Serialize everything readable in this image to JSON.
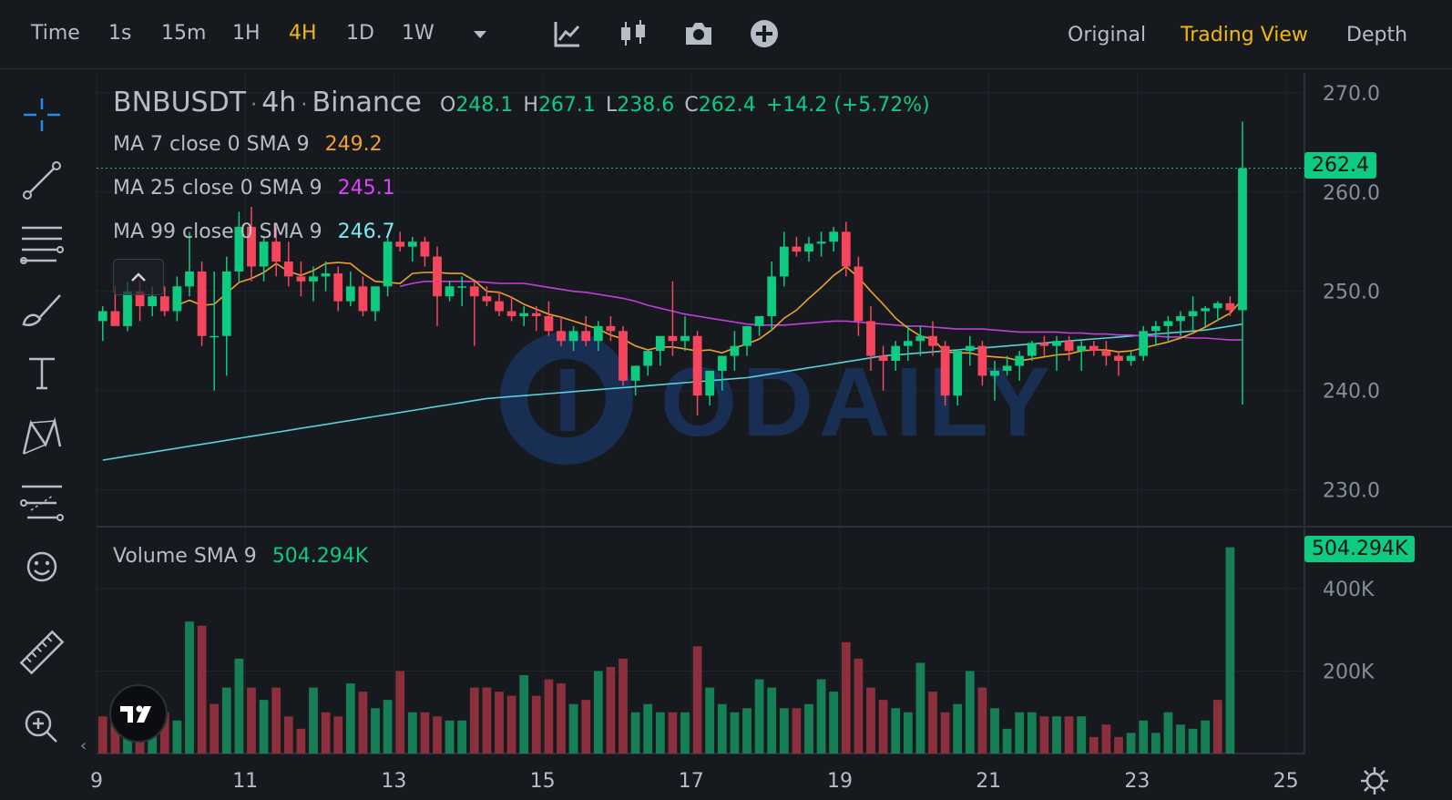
{
  "toolbar": {
    "intervals": [
      {
        "label": "Time",
        "active": false
      },
      {
        "label": "1s",
        "active": false
      },
      {
        "label": "15m",
        "active": false
      },
      {
        "label": "1H",
        "active": false
      },
      {
        "label": "4H",
        "active": true
      },
      {
        "label": "1D",
        "active": false
      },
      {
        "label": "1W",
        "active": false
      }
    ],
    "tools": [
      "indicator-icon",
      "chart-type-icon",
      "screenshot-icon",
      "add-icon"
    ],
    "views": [
      {
        "label": "Original",
        "active": false
      },
      {
        "label": "Trading View",
        "active": true
      },
      {
        "label": "Depth",
        "active": false
      }
    ]
  },
  "sidebar": {
    "tools": [
      "crosshair-icon",
      "trend-line-icon",
      "horizontal-lines-icon",
      "brush-icon",
      "text-icon",
      "pattern-icon",
      "forecast-icon",
      "emoji-icon",
      "ruler-icon",
      "zoom-in-icon"
    ]
  },
  "legend": {
    "symbol": "BNBUSDT",
    "interval": "4h",
    "exchange": "Binance",
    "o_label": "O",
    "o_value": "248.1",
    "h_label": "H",
    "h_value": "267.1",
    "l_label": "L",
    "l_value": "238.6",
    "c_label": "C",
    "c_value": "262.4",
    "change": "+14.2 (+5.72%)",
    "ma7_label": "MA 7 close 0 SMA 9",
    "ma7_value": "249.2",
    "ma25_label": "MA 25 close 0 SMA 9",
    "ma25_value": "245.1",
    "ma99_label": "MA 99 close 0 SMA 9",
    "ma99_value": "246.7",
    "volume_label": "Volume SMA 9",
    "volume_value": "504.294K"
  },
  "watermark": "ODAILY",
  "current_price_tag": "262.4",
  "current_volume_tag": "504.294K",
  "colors": {
    "up": "#0ecb81",
    "down": "#f6465d",
    "vol_up": "#167f55",
    "vol_down": "#8c2f3c",
    "ma7": "#f0a02c",
    "ma25": "#c43fd9",
    "ma99": "#5ccfdc",
    "accent": "#f0b90b",
    "background": "#161a1e"
  },
  "chart_data": {
    "type": "candlestick",
    "price_axis": {
      "ticks": [
        "270.0",
        "260.0",
        "250.0",
        "240.0",
        "230.0"
      ],
      "range": [
        226.3,
        272.0
      ]
    },
    "volume_axis": {
      "ticks": [
        "400K",
        "200K"
      ],
      "range": [
        0,
        550000
      ]
    },
    "x_axis": {
      "ticks": [
        "9",
        "11",
        "13",
        "15",
        "17",
        "19",
        "21",
        "23",
        "25"
      ],
      "range": [
        9.0,
        25.25
      ],
      "candle_hours": 4
    },
    "candles_start_day": 9.0,
    "ohlc": [
      [
        247.0,
        248.5,
        245.0,
        248.0
      ],
      [
        248.0,
        250.5,
        247.0,
        246.5
      ],
      [
        246.5,
        251.0,
        246.0,
        250.0
      ],
      [
        250.0,
        251.0,
        247.0,
        248.5
      ],
      [
        248.5,
        250.5,
        247.5,
        249.5
      ],
      [
        249.5,
        250.5,
        247.5,
        248.0
      ],
      [
        248.0,
        251.5,
        247.0,
        250.5
      ],
      [
        250.5,
        256.0,
        249.5,
        252.0
      ],
      [
        252.0,
        253.0,
        244.5,
        245.5
      ],
      [
        245.5,
        252.0,
        240.0,
        245.5
      ],
      [
        245.5,
        253.5,
        241.5,
        252.0
      ],
      [
        252.0,
        258.0,
        251.0,
        256.5
      ],
      [
        256.5,
        258.5,
        251.0,
        252.5
      ],
      [
        252.5,
        255.5,
        251.0,
        255.0
      ],
      [
        255.0,
        256.5,
        251.5,
        253.0
      ],
      [
        253.0,
        255.0,
        250.5,
        251.5
      ],
      [
        251.5,
        253.0,
        249.5,
        251.0
      ],
      [
        251.0,
        252.5,
        249.0,
        251.5
      ],
      [
        251.5,
        253.0,
        250.0,
        251.8
      ],
      [
        251.8,
        252.5,
        248.0,
        249.0
      ],
      [
        249.0,
        252.0,
        248.5,
        250.5
      ],
      [
        250.5,
        251.5,
        247.5,
        248.0
      ],
      [
        248.0,
        250.0,
        247.0,
        250.5
      ],
      [
        250.5,
        255.5,
        249.5,
        255.0
      ],
      [
        255.0,
        256.0,
        254.0,
        254.5
      ],
      [
        254.5,
        255.5,
        253.0,
        255.0
      ],
      [
        255.0,
        255.5,
        252.5,
        253.5
      ],
      [
        253.5,
        254.5,
        246.5,
        249.5
      ],
      [
        249.5,
        251.0,
        249.0,
        250.5
      ],
      [
        250.5,
        251.5,
        248.5,
        250.5
      ],
      [
        250.5,
        251.0,
        244.5,
        249.5
      ],
      [
        249.5,
        250.5,
        248.5,
        249.0
      ],
      [
        249.0,
        250.0,
        247.5,
        248.0
      ],
      [
        248.0,
        249.5,
        247.0,
        247.5
      ],
      [
        247.5,
        248.5,
        246.5,
        247.8
      ],
      [
        247.8,
        248.5,
        246.0,
        247.5
      ],
      [
        247.5,
        249.0,
        245.5,
        246.0
      ],
      [
        246.0,
        247.5,
        244.5,
        245.0
      ],
      [
        245.0,
        246.5,
        244.0,
        246.0
      ],
      [
        246.0,
        247.5,
        244.5,
        245.0
      ],
      [
        245.0,
        247.0,
        244.0,
        246.5
      ],
      [
        246.5,
        247.5,
        245.0,
        246.0
      ],
      [
        246.0,
        246.5,
        240.5,
        241.0
      ],
      [
        241.0,
        242.5,
        239.5,
        242.5
      ],
      [
        242.5,
        244.0,
        241.5,
        244.0
      ],
      [
        244.0,
        245.5,
        242.5,
        245.5
      ],
      [
        245.5,
        251.0,
        243.5,
        245.0
      ],
      [
        245.0,
        247.5,
        244.0,
        245.5
      ],
      [
        245.5,
        246.0,
        237.5,
        239.5
      ],
      [
        239.5,
        241.5,
        238.5,
        242.0
      ],
      [
        242.0,
        243.5,
        240.0,
        243.5
      ],
      [
        243.5,
        246.0,
        242.0,
        244.5
      ],
      [
        244.5,
        246.5,
        243.5,
        246.5
      ],
      [
        246.5,
        247.5,
        245.5,
        247.5
      ],
      [
        247.5,
        253.0,
        246.0,
        251.5
      ],
      [
        251.5,
        256.0,
        250.5,
        254.5
      ],
      [
        254.5,
        255.5,
        253.5,
        254.0
      ],
      [
        254.0,
        255.5,
        253.0,
        254.8
      ],
      [
        254.8,
        256.0,
        253.5,
        255.0
      ],
      [
        255.0,
        256.5,
        254.0,
        256.0
      ],
      [
        256.0,
        257.0,
        251.5,
        252.5
      ],
      [
        252.5,
        253.5,
        245.5,
        247.0
      ],
      [
        247.0,
        248.5,
        242.0,
        243.5
      ],
      [
        243.5,
        244.5,
        240.0,
        243.0
      ],
      [
        243.0,
        245.0,
        242.0,
        244.5
      ],
      [
        244.5,
        246.5,
        243.0,
        245.0
      ],
      [
        245.0,
        246.5,
        243.5,
        245.5
      ],
      [
        245.5,
        247.0,
        243.5,
        244.5
      ],
      [
        244.5,
        245.0,
        238.5,
        239.5
      ],
      [
        239.5,
        244.0,
        238.5,
        244.0
      ],
      [
        244.0,
        245.5,
        242.5,
        244.5
      ],
      [
        244.5,
        245.0,
        240.5,
        241.5
      ],
      [
        241.5,
        243.0,
        239.0,
        242.0
      ],
      [
        242.0,
        243.5,
        241.5,
        242.5
      ],
      [
        242.5,
        244.0,
        241.0,
        243.5
      ],
      [
        243.5,
        245.0,
        243.0,
        244.8
      ],
      [
        244.8,
        245.5,
        243.5,
        244.5
      ],
      [
        244.5,
        245.5,
        242.0,
        245.0
      ],
      [
        245.0,
        245.5,
        243.0,
        244.0
      ],
      [
        244.0,
        245.0,
        242.0,
        244.5
      ],
      [
        244.5,
        245.0,
        243.5,
        244.0
      ],
      [
        244.0,
        245.0,
        242.5,
        243.5
      ],
      [
        243.5,
        244.0,
        241.5,
        243.0
      ],
      [
        243.0,
        244.0,
        242.5,
        243.5
      ],
      [
        243.5,
        246.5,
        243.0,
        246.0
      ],
      [
        246.0,
        247.0,
        244.5,
        246.5
      ],
      [
        246.5,
        247.5,
        245.0,
        247.0
      ],
      [
        247.0,
        248.0,
        245.5,
        247.5
      ],
      [
        247.5,
        249.5,
        246.0,
        248.0
      ],
      [
        248.0,
        248.5,
        246.5,
        248.3
      ],
      [
        248.3,
        249.0,
        247.0,
        248.8
      ],
      [
        248.8,
        249.5,
        247.5,
        248.1
      ],
      [
        248.1,
        267.1,
        238.6,
        262.4
      ]
    ],
    "ma7": [
      null,
      null,
      null,
      null,
      null,
      null,
      248.6,
      249.1,
      248.6,
      248.7,
      249.8,
      250.9,
      251.3,
      251.9,
      252.8,
      252.0,
      251.6,
      252.1,
      252.8,
      252.9,
      252.8,
      251.8,
      251.0,
      250.9,
      250.8,
      251.8,
      251.9,
      251.9,
      251.8,
      251.8,
      251.1,
      250.0,
      249.9,
      249.4,
      248.7,
      248.2,
      247.7,
      247.4,
      247.0,
      246.6,
      246.2,
      245.6,
      245.2,
      244.5,
      244.1,
      244.4,
      244.4,
      244.2,
      244.0,
      244.1,
      243.8,
      244.3,
      244.7,
      245.2,
      246.1,
      247.3,
      248.1,
      249.3,
      250.4,
      251.6,
      252.5,
      251.4,
      250.0,
      248.7,
      247.3,
      246.3,
      245.5,
      245.2,
      243.9,
      243.8,
      243.8,
      243.5,
      243.4,
      243.3,
      243.0,
      243.2,
      243.4,
      243.6,
      243.7,
      244.0,
      244.1,
      244.1,
      243.9,
      244.0,
      244.3,
      244.6,
      244.9,
      245.3,
      245.8,
      246.4,
      247.1,
      247.8,
      249.2
    ],
    "ma25": [
      null,
      null,
      null,
      null,
      null,
      null,
      null,
      null,
      null,
      null,
      null,
      null,
      null,
      null,
      null,
      null,
      null,
      null,
      null,
      null,
      null,
      null,
      null,
      null,
      250.5,
      250.8,
      251.0,
      251.0,
      251.0,
      251.0,
      251.0,
      250.9,
      250.8,
      250.8,
      250.8,
      250.6,
      250.4,
      250.2,
      250.0,
      249.9,
      249.7,
      249.5,
      249.3,
      249.0,
      248.6,
      248.3,
      248.0,
      247.7,
      247.5,
      247.3,
      247.1,
      246.9,
      246.7,
      246.6,
      246.6,
      246.6,
      246.7,
      246.8,
      246.9,
      247.0,
      247.0,
      246.9,
      246.8,
      246.7,
      246.6,
      246.5,
      246.5,
      246.4,
      246.3,
      246.2,
      246.2,
      246.2,
      246.1,
      246.0,
      245.9,
      245.9,
      245.9,
      245.9,
      245.8,
      245.8,
      245.7,
      245.7,
      245.6,
      245.6,
      245.5,
      245.5,
      245.4,
      245.4,
      245.3,
      245.3,
      245.2,
      245.1,
      245.1
    ],
    "ma99": [
      233.0,
      233.2,
      233.4,
      233.6,
      233.8,
      234.0,
      234.2,
      234.4,
      234.6,
      234.8,
      235.0,
      235.2,
      235.4,
      235.6,
      235.8,
      236.0,
      236.2,
      236.4,
      236.6,
      236.8,
      237.0,
      237.2,
      237.4,
      237.6,
      237.8,
      238.0,
      238.2,
      238.4,
      238.6,
      238.8,
      239.0,
      239.2,
      239.3,
      239.4,
      239.5,
      239.6,
      239.7,
      239.8,
      239.9,
      240.0,
      240.1,
      240.2,
      240.3,
      240.4,
      240.5,
      240.6,
      240.7,
      240.8,
      240.9,
      241.0,
      241.1,
      241.2,
      241.3,
      241.5,
      241.7,
      241.9,
      242.1,
      242.3,
      242.5,
      242.7,
      242.9,
      243.1,
      243.3,
      243.5,
      243.6,
      243.7,
      243.8,
      243.9,
      244.0,
      244.1,
      244.2,
      244.3,
      244.4,
      244.5,
      244.6,
      244.7,
      244.8,
      244.9,
      245.0,
      245.1,
      245.2,
      245.3,
      245.4,
      245.5,
      245.6,
      245.7,
      245.8,
      245.9,
      246.0,
      246.1,
      246.3,
      246.5,
      246.7
    ],
    "volume": [
      90000,
      110000,
      80000,
      80000,
      90000,
      100000,
      80000,
      320000,
      310000,
      120000,
      160000,
      230000,
      160000,
      130000,
      160000,
      90000,
      60000,
      160000,
      100000,
      90000,
      170000,
      150000,
      110000,
      130000,
      200000,
      100000,
      100000,
      90000,
      80000,
      80000,
      160000,
      160000,
      150000,
      140000,
      190000,
      140000,
      180000,
      170000,
      120000,
      130000,
      200000,
      210000,
      230000,
      100000,
      120000,
      100000,
      100000,
      100000,
      260000,
      160000,
      120000,
      100000,
      110000,
      180000,
      160000,
      110000,
      110000,
      120000,
      180000,
      150000,
      270000,
      230000,
      160000,
      130000,
      110000,
      100000,
      220000,
      150000,
      100000,
      120000,
      200000,
      160000,
      110000,
      60000,
      100000,
      100000,
      90000,
      90000,
      90000,
      90000,
      40000,
      70000,
      40000,
      50000,
      80000,
      50000,
      100000,
      70000,
      60000,
      80000,
      130000,
      500000
    ],
    "volume_dirs": [
      "d",
      "d",
      "u",
      "d",
      "u",
      "d",
      "u",
      "u",
      "d",
      "d",
      "u",
      "u",
      "d",
      "u",
      "d",
      "d",
      "d",
      "u",
      "d",
      "d",
      "u",
      "d",
      "u",
      "u",
      "d",
      "u",
      "d",
      "d",
      "u",
      "u",
      "d",
      "d",
      "d",
      "d",
      "u",
      "d",
      "d",
      "d",
      "u",
      "d",
      "u",
      "d",
      "d",
      "u",
      "u",
      "u",
      "d",
      "u",
      "d",
      "u",
      "u",
      "u",
      "u",
      "u",
      "u",
      "u",
      "d",
      "u",
      "u",
      "u",
      "d",
      "d",
      "d",
      "d",
      "u",
      "u",
      "u",
      "d",
      "d",
      "u",
      "u",
      "d",
      "u",
      "u",
      "u",
      "u",
      "d",
      "u",
      "d",
      "u",
      "d",
      "d",
      "d",
      "u",
      "u",
      "u",
      "u",
      "u",
      "u",
      "u",
      "d",
      "u"
    ]
  }
}
